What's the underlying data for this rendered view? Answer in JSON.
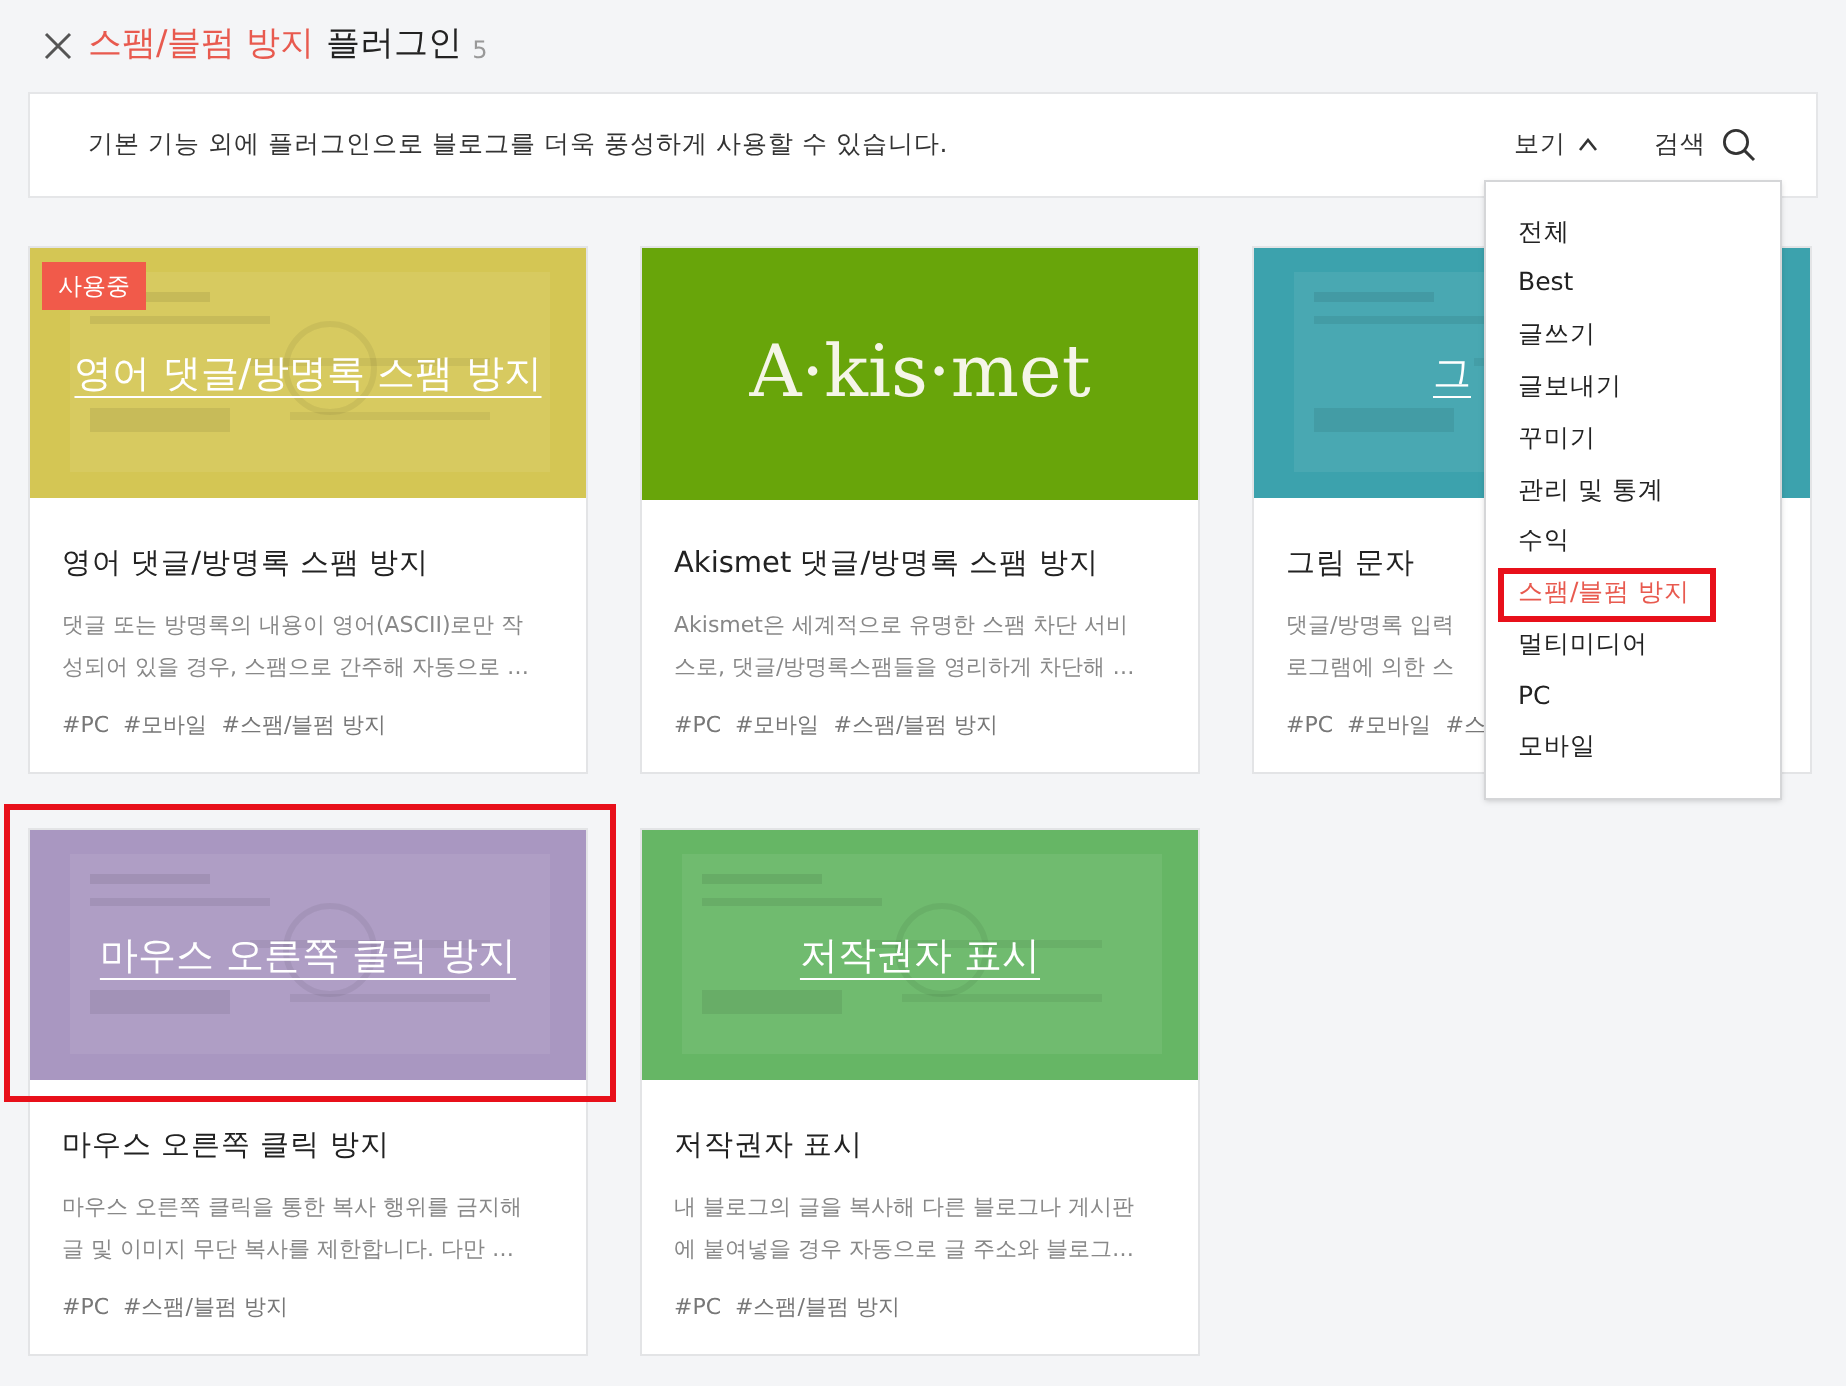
{
  "header": {
    "category": "스팸/블펌 방지",
    "title": "플러그인",
    "count": "5"
  },
  "info_bar": {
    "text": "기본 기능 외에 플러그인으로 블로그를 더욱 풍성하게 사용할 수 있습니다.",
    "view_label": "보기",
    "search_label": "검색"
  },
  "cards": [
    {
      "banner_text": "영어 댓글/방명록 스팸 방지",
      "kind": "picture",
      "color": "#d4c654",
      "badge": "사용중",
      "annotated": false,
      "title": "영어 댓글/방명록 스팸 방지",
      "description": [
        "댓글 또는 방명록의 내용이 영어(ASCII)로만 작",
        "성되어 있을 경우, 스팸으로 간주해 자동으로 …"
      ],
      "tags": [
        "#PC",
        "#모바일",
        "#스팸/블펌 방지"
      ]
    },
    {
      "banner_text": "A·kis·met",
      "kind": "logo",
      "color": "#68a50a",
      "annotated": false,
      "title": "Akismet 댓글/방명록 스팸 방지",
      "description": [
        "Akismet은 세계적으로 유명한 스팸 차단 서비",
        "스로, 댓글/방명록스팸들을 영리하게 차단해 …"
      ],
      "tags": [
        "#PC",
        "#모바일",
        "#스팸/블펌 방지"
      ]
    },
    {
      "banner_text": "그",
      "kind": "picture",
      "color": "#3ca2ad",
      "banner_cut": true,
      "annotated": false,
      "title": "그림 문자",
      "description": [
        "댓글/방명록 입력",
        "로그램에 의한 스"
      ],
      "tags": [
        "#PC",
        "#모바일",
        "#스"
      ]
    },
    {
      "banner_text": "마우스 오른쪽 클릭 방지",
      "kind": "picture",
      "color": "#a997c1",
      "annotated": true,
      "title": "마우스 오른쪽 클릭 방지",
      "description": [
        "마우스 오른쪽 클릭을 통한 복사 행위를 금지해",
        "글 및 이미지 무단 복사를 제한합니다. 다만 …"
      ],
      "tags": [
        "#PC",
        "#스팸/블펌 방지"
      ]
    },
    {
      "banner_text": "저작권자 표시",
      "kind": "picture",
      "color": "#66b665",
      "annotated": false,
      "title": "저작권자 표시",
      "description": [
        "내 블로그의 글을 복사해 다른 블로그나 게시판",
        "에 붙여넣을 경우 자동으로 글 주소와 블로그…"
      ],
      "tags": [
        "#PC",
        "#스팸/블펌 방지"
      ]
    }
  ],
  "view_menu": {
    "expanded": true,
    "items": [
      {
        "label": "전체",
        "selected": false,
        "annotated": false
      },
      {
        "label": "Best",
        "selected": false,
        "annotated": false
      },
      {
        "label": "글쓰기",
        "selected": false,
        "annotated": false
      },
      {
        "label": "글보내기",
        "selected": false,
        "annotated": false
      },
      {
        "label": "꾸미기",
        "selected": false,
        "annotated": false
      },
      {
        "label": "관리 및 통계",
        "selected": false,
        "annotated": false
      },
      {
        "label": "수익",
        "selected": false,
        "annotated": false
      },
      {
        "label": "스팸/블펌 방지",
        "selected": true,
        "annotated": true
      },
      {
        "label": "멀티미디어",
        "selected": false,
        "annotated": false
      },
      {
        "label": "PC",
        "selected": false,
        "annotated": false
      },
      {
        "label": "모바일",
        "selected": false,
        "annotated": false
      }
    ]
  }
}
